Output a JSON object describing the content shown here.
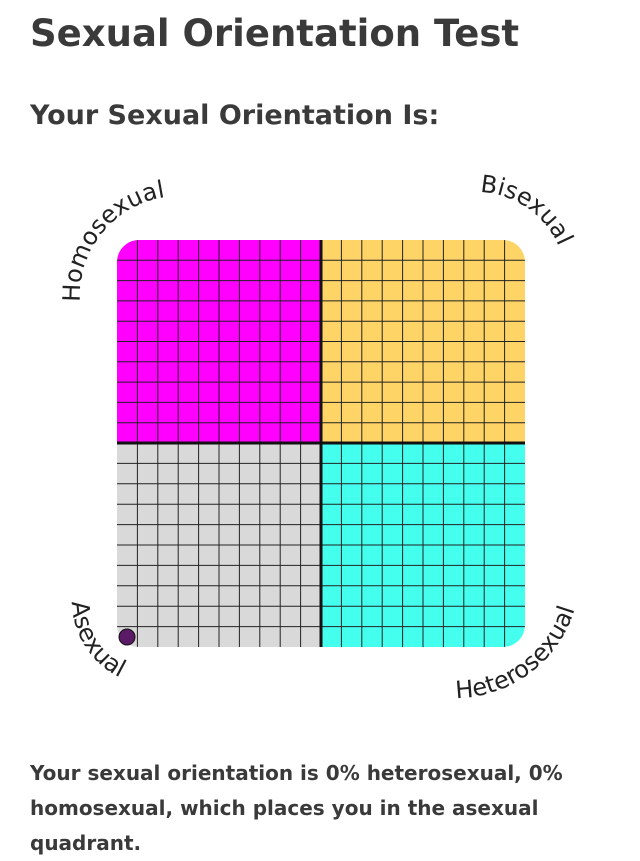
{
  "page": {
    "title": "Sexual Orientation Test",
    "subheading": "Your Sexual Orientation Is:",
    "result_text": "Your sexual orientation is 0% heterosexual, 0% homosexual, which places you in the asexual quadrant."
  },
  "chart_data": {
    "type": "scatter",
    "quadrants": [
      {
        "label": "Homosexual",
        "position": "top-left",
        "color": "#ff00ff"
      },
      {
        "label": "Bisexual",
        "position": "top-right",
        "color": "#ffd466"
      },
      {
        "label": "Asexual",
        "position": "bottom-left",
        "color": "#d9d9d9"
      },
      {
        "label": "Heterosexual",
        "position": "bottom-right",
        "color": "#44ffee"
      }
    ],
    "grid": true,
    "point": {
      "heterosexual": 0,
      "homosexual": 0,
      "color": "#5b1a66"
    },
    "xlim": [
      0,
      100
    ],
    "ylim": [
      0,
      100
    ]
  }
}
